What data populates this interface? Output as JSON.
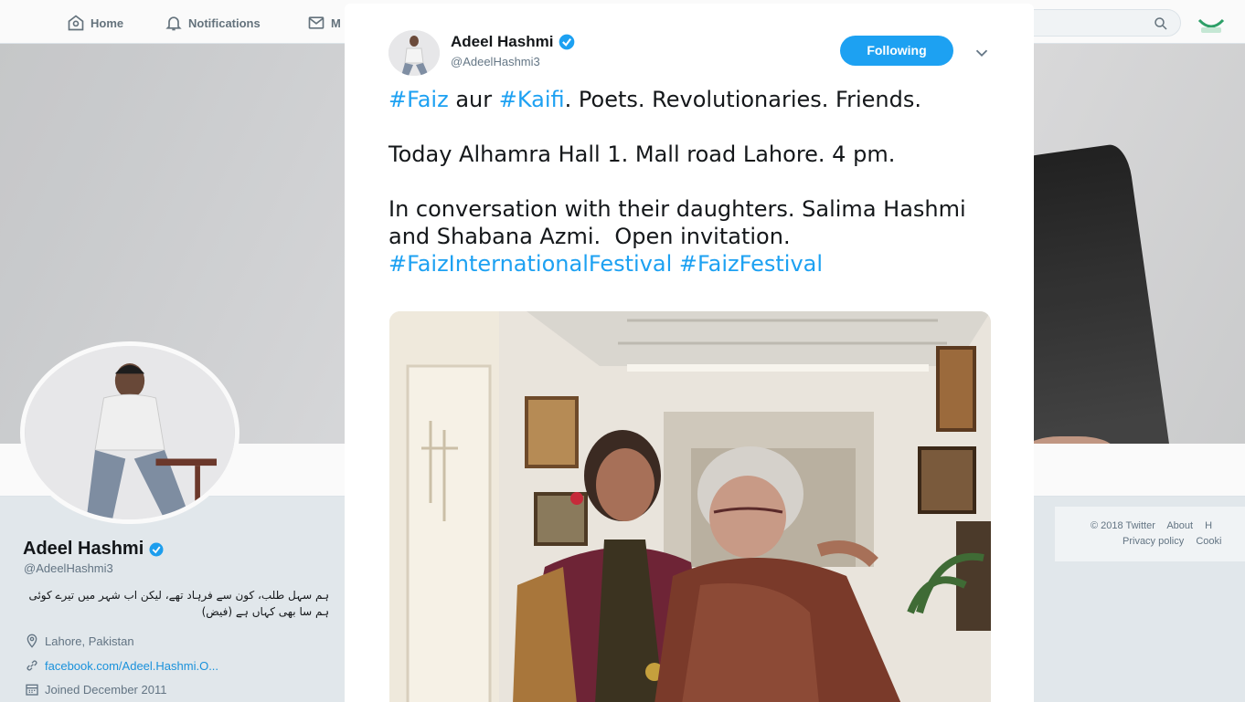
{
  "nav": {
    "home": "Home",
    "notifications": "Notifications",
    "messages_partial": "M",
    "search_partial": "r"
  },
  "profile": {
    "name": "Adeel Hashmi",
    "handle": "@AdeelHashmi3",
    "bio": "ہم سہل طلب، کون سے فرہاد تھے، لیکن اب شہر میں تیرے کوئی ہم سا بھی کہاں ہے (فیض)",
    "location": "Lahore, Pakistan",
    "url": "facebook.com/Adeel.Hashmi.O...",
    "joined": "Joined December 2011"
  },
  "footer": {
    "copyright": "© 2018 Twitter",
    "about": "About",
    "help_partial": "H",
    "privacy": "Privacy policy",
    "cookies_partial": "Cooki"
  },
  "tweet": {
    "author_name": "Adeel Hashmi",
    "author_handle": "@AdeelHashmi3",
    "follow_label": "Following",
    "text_parts": {
      "h1": "#Faiz",
      "t1": " aur ",
      "h2": "#Kaifi",
      "t2": ". Poets. Revolutionaries. Friends.\n\nToday Alhamra Hall 1. Mall road Lahore. 4 pm.\n\nIn conversation with their daughters. Salima Hashmi and Shabana Azmi.  Open invitation. ",
      "h3": "#FaizInternationalFestival",
      "t3": " ",
      "h4": "#FaizFestival"
    }
  },
  "colors": {
    "accent": "#1da1f2",
    "link": "#1b95e0",
    "verified": "#1da1f2"
  }
}
